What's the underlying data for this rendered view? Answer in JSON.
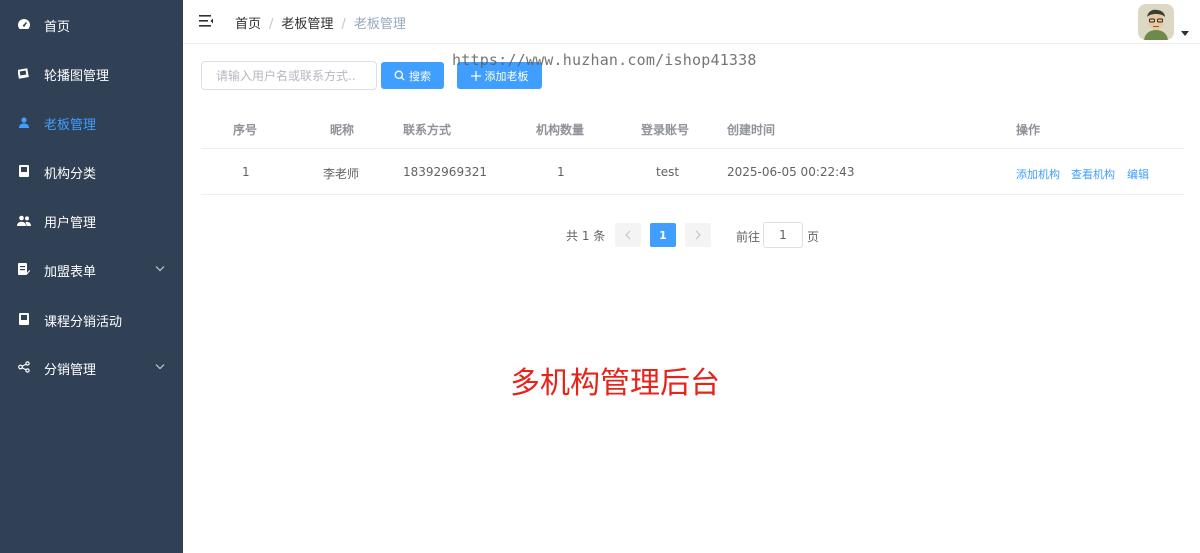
{
  "sidebar": {
    "items": [
      {
        "label": "首页",
        "icon": "dashboard-icon",
        "active": false,
        "has_arrow": false
      },
      {
        "label": "轮播图管理",
        "icon": "image-icon",
        "active": false,
        "has_arrow": false
      },
      {
        "label": "老板管理",
        "icon": "user-icon",
        "active": true,
        "has_arrow": false
      },
      {
        "label": "机构分类",
        "icon": "book-icon",
        "active": false,
        "has_arrow": false
      },
      {
        "label": "用户管理",
        "icon": "users-icon",
        "active": false,
        "has_arrow": false
      },
      {
        "label": "加盟表单",
        "icon": "form-icon",
        "active": false,
        "has_arrow": true
      },
      {
        "label": "课程分销活动",
        "icon": "book-icon",
        "active": false,
        "has_arrow": false
      },
      {
        "label": "分销管理",
        "icon": "share-icon",
        "active": false,
        "has_arrow": true
      }
    ],
    "bg_color": "#304156",
    "active_color": "#409eff"
  },
  "header": {
    "breadcrumb": [
      "首页",
      "老板管理",
      "老板管理"
    ],
    "separator": "/"
  },
  "toolbar": {
    "search_placeholder": "请输入用户名或联系方式..",
    "search_label": "搜索",
    "add_label": "添加老板",
    "accent_color": "#409eff"
  },
  "watermark": "https://www.huzhan.com/ishop41338",
  "table": {
    "columns": [
      "序号",
      "昵称",
      "联系方式",
      "机构数量",
      "登录账号",
      "创建时间",
      "操作"
    ],
    "rows": [
      {
        "index": "1",
        "nickname": "李老师",
        "contact": "18392969321",
        "org_count": "1",
        "account": "test",
        "created": "2025-06-05 00:22:43",
        "actions": [
          "添加机构",
          "查看机构",
          "编辑"
        ]
      }
    ]
  },
  "pagination": {
    "total_text": "共 1 条",
    "current_page": "1",
    "goto_prefix": "前往",
    "goto_value": "1",
    "goto_suffix": "页"
  },
  "banner": "多机构管理后台"
}
